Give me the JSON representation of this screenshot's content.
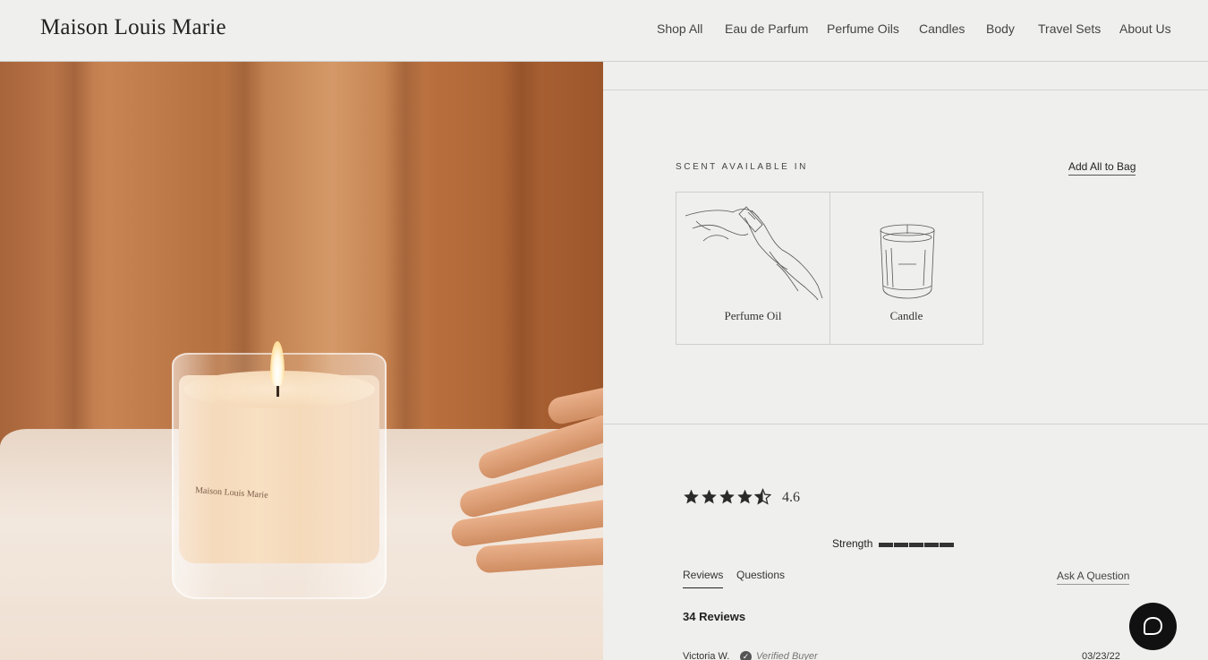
{
  "header": {
    "logo": "Maison Louis Marie",
    "nav": [
      "Shop All",
      "Eau de Parfum",
      "Perfume Oils",
      "Candles",
      "Body",
      "Travel Sets",
      "About Us"
    ]
  },
  "hero": {
    "candle_brand_text": "Maison Louis Marie"
  },
  "scent": {
    "label": "SCENT AVAILABLE IN",
    "add_all": "Add All to Bag",
    "options": [
      {
        "label": "Perfume Oil",
        "icon": "perfume-oil-sketch-icon"
      },
      {
        "label": "Candle",
        "icon": "candle-sketch-icon"
      }
    ]
  },
  "reviews": {
    "rating": "4.6",
    "rating_value": 4.6,
    "stars_max": 5,
    "strength_label": "Strength",
    "strength_level": 5,
    "tabs": [
      "Reviews",
      "Questions"
    ],
    "active_tab": "Reviews",
    "ask_question": "Ask A Question",
    "count_label": "34 Reviews",
    "first_review": {
      "reviewer": "Victoria W.",
      "verified": "Verified Buyer",
      "date": "03/23/22"
    }
  },
  "chat": {
    "icon": "chat-bubble-icon"
  },
  "colors": {
    "background": "#efefed",
    "chat_button": "#111111",
    "text": "#2a2a2a"
  }
}
